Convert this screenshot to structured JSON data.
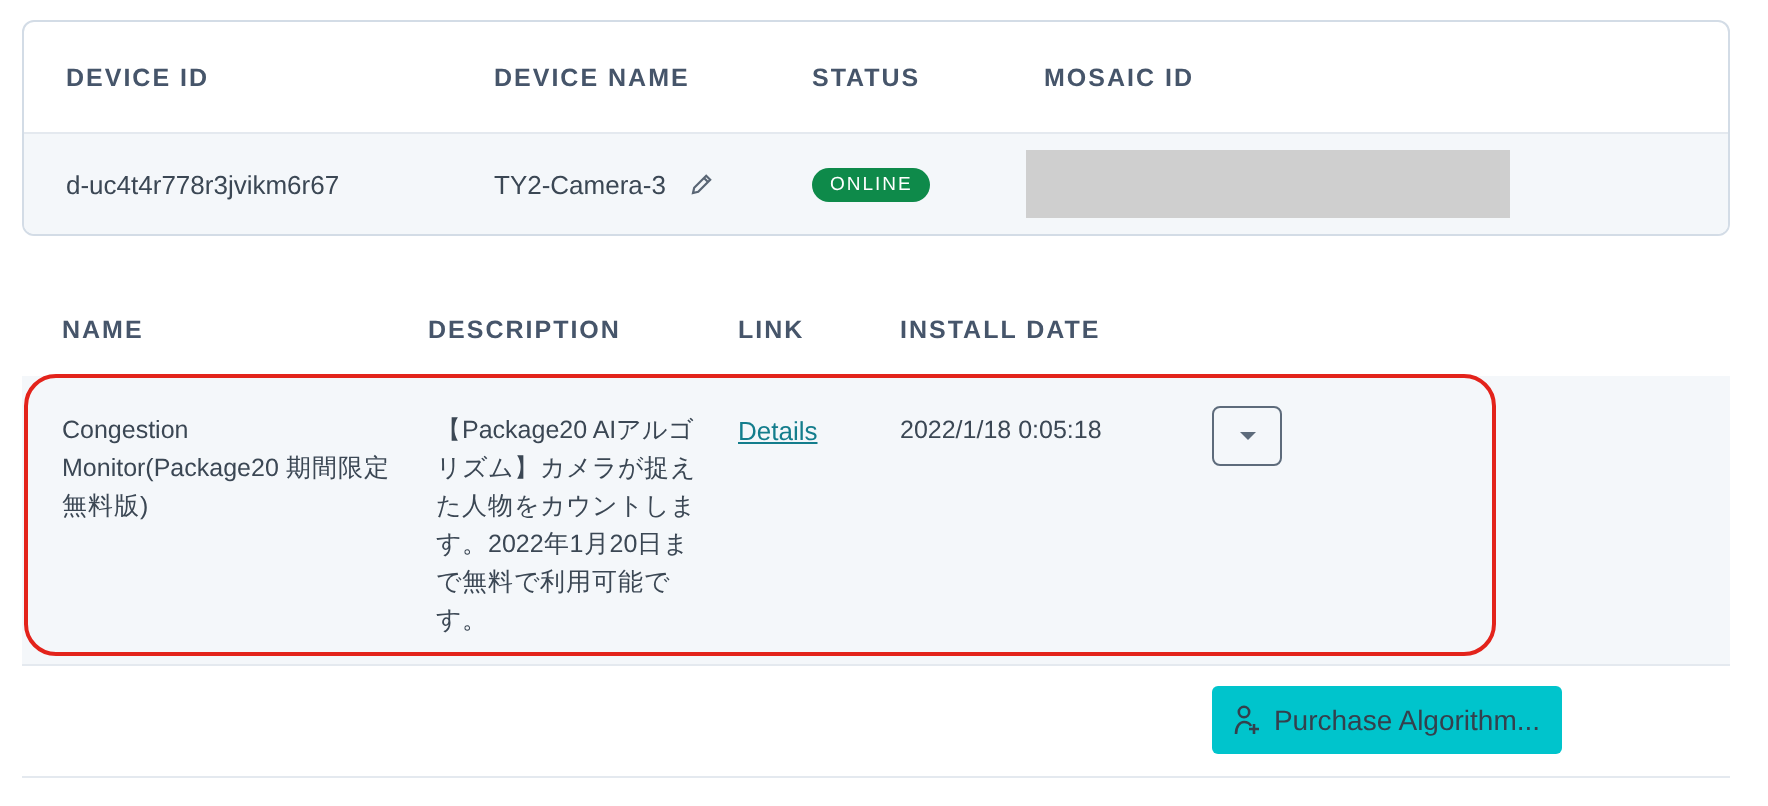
{
  "device_table": {
    "columns": [
      "DEVICE ID",
      "DEVICE NAME",
      "STATUS",
      "MOSAIC ID"
    ],
    "row": {
      "device_id": "d-uc4t4r778r3jvikm6r67",
      "device_name": "TY2-Camera-3",
      "status": "ONLINE",
      "online": true,
      "mosaic_id_redacted": true
    }
  },
  "algorithm_table": {
    "columns": [
      "NAME",
      "DESCRIPTION",
      "LINK",
      "INSTALL DATE"
    ],
    "rows": [
      {
        "name": "Congestion Monitor(Package20 期間限定無料版)",
        "description": "【Package20 AIアルゴリズム】カメラが捉えた人物をカウントします。2022年1月20日まで無料で利用可能です。",
        "link": "Details",
        "install_date": "2022/1/18 0:05:18",
        "highlighted": true
      }
    ]
  },
  "purchase_button": {
    "label": "Purchase Algorithm..."
  }
}
